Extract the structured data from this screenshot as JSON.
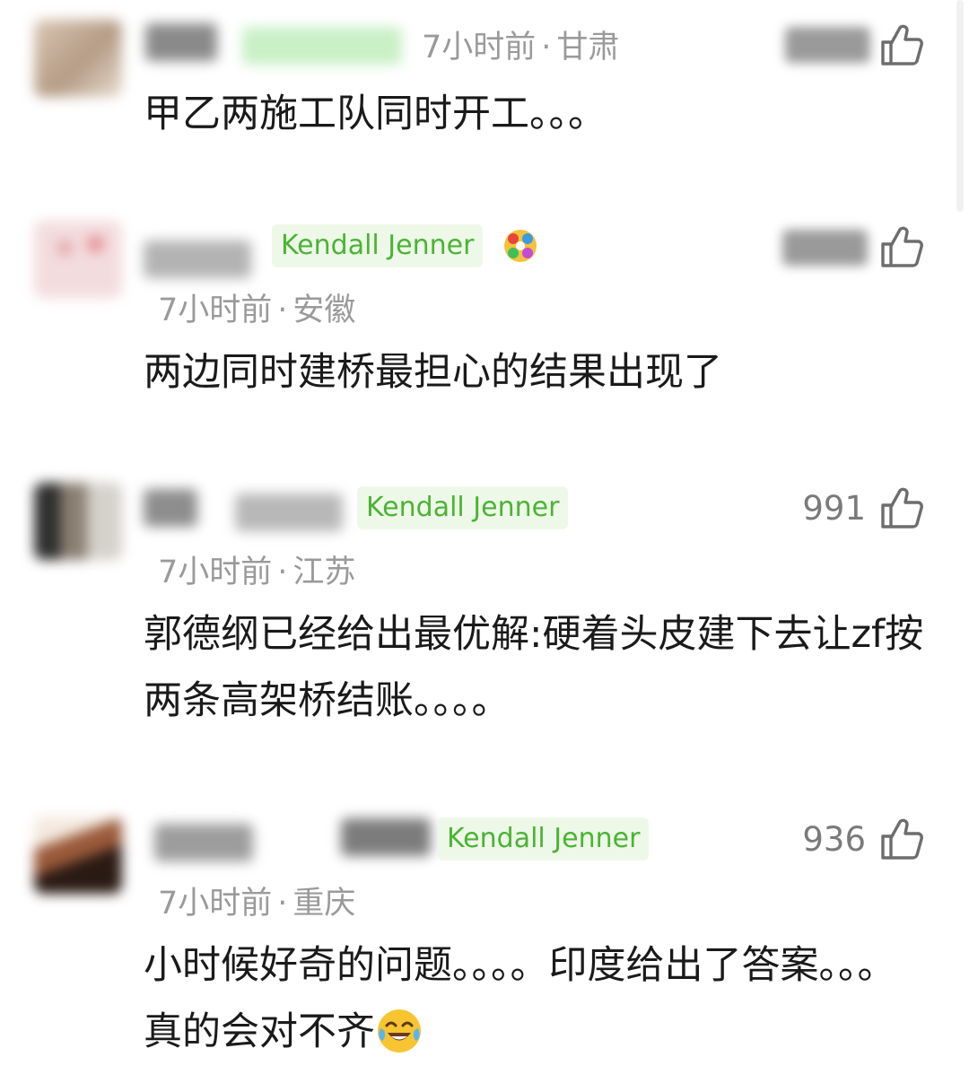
{
  "comments": [
    {
      "badge": "",
      "time": "7小时前",
      "location": "甘肃",
      "likes": "",
      "text": "甲乙两施工队同时开工。。。"
    },
    {
      "badge": "Kendall Jenner",
      "time": "7小时前",
      "location": "安徽",
      "likes": "",
      "text": "两边同时建桥最担心的结果出现了"
    },
    {
      "badge": "Kendall Jenner",
      "time": "7小时前",
      "location": "江苏",
      "likes": "991",
      "text": "郭德纲已经给出最优解:硬着头皮建下去让zf按两条高架桥结账。。。。"
    },
    {
      "badge": "Kendall Jenner",
      "time": "7小时前",
      "location": "重庆",
      "likes": "936",
      "text": "小时候好奇的问题。。。。印度给出了答案。。。真的会对不齐"
    }
  ],
  "separator": "·",
  "icons": {
    "like": "thumbs-up-icon",
    "emoji": "tears-of-joy-emoji"
  },
  "colors": {
    "badge_text": "#4ab434",
    "badge_bg": "#eef8e8",
    "meta": "#9a9a9a",
    "body_text": "#1a1a1a"
  }
}
